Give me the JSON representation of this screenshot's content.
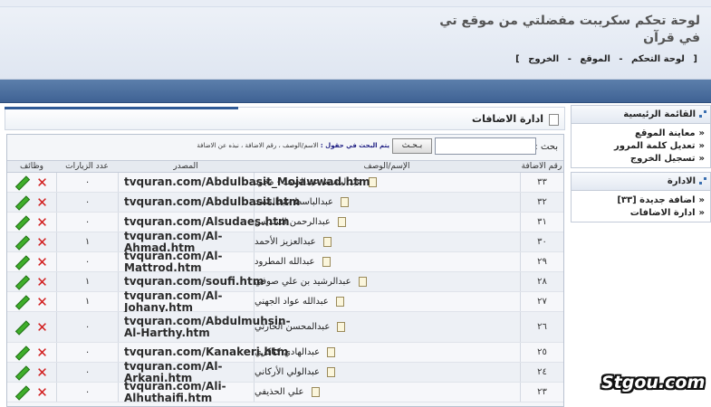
{
  "header": {
    "title_line1": "لوحة تحكم سكريبت مفضلتي من موقع تي",
    "title_line2": "في قرآن",
    "links": [
      "[",
      "لوحة التحكم",
      "-",
      "الموقع",
      "-",
      "الخروج",
      "]"
    ]
  },
  "sidebar": {
    "main_menu": {
      "title": "القائمة الرئيسية",
      "items": [
        "معاينة الموقع",
        "تعديل كلمة المرور",
        "تسجيل الخروج"
      ]
    },
    "admin_menu": {
      "title": "الادارة",
      "items": [
        "اضافة جديدة [٣٣]",
        "ادارة الاضافات"
      ]
    }
  },
  "main": {
    "title": "ادارة الاضافات",
    "search": {
      "label": "بحث :",
      "value": "",
      "button_label": "بـحـث",
      "hint_bold": "يتم البحث في حقول :",
      "hint_rest": "الاسم/الوصف ، رقم الاضافة ، نبذه عن الاضافة"
    },
    "table": {
      "headers": {
        "number": "رقم الاضافة",
        "name": "الإسم/الوصف",
        "source": "المصدر",
        "visits": "عدد الزيارات",
        "actions": "وظائف"
      },
      "rows": [
        {
          "number": "٣٣",
          "name": "عبدالباسط عبدالصمد - مجود",
          "source": "tvquran.com/Abdulbasit_Mojawwad.htm",
          "visits": "٠"
        },
        {
          "number": "٣٢",
          "name": "عبدالباسط عبدالصمد",
          "source": "tvquran.com/Abdulbasit.htm",
          "visits": "٠"
        },
        {
          "number": "٣١",
          "name": "عبدالرحمن السديس",
          "source": "tvquran.com/Alsudaes.htm",
          "visits": "٠"
        },
        {
          "number": "٣٠",
          "name": "عبدالعزيز الأحمد",
          "source": "tvquran.com/Al-Ahmad.htm",
          "visits": "١"
        },
        {
          "number": "٢٩",
          "name": "عبدالله المطرود",
          "source": "tvquran.com/Al-Mattrod.htm",
          "visits": "٠"
        },
        {
          "number": "٢٨",
          "name": "عبدالرشيد بن علي صوفي",
          "source": "tvquran.com/soufi.htm",
          "visits": "١"
        },
        {
          "number": "٢٧",
          "name": "عبدالله عواد الجهني",
          "source": "tvquran.com/Al-Johany.htm",
          "visits": "١"
        },
        {
          "number": "٢٦",
          "name": "عبدالمحسن الحارثي",
          "source": "tvquran.com/Abdulmuhsin-Al-Harthy.htm",
          "visits": "٠"
        },
        {
          "number": "٢٥",
          "name": "عبدالهادي كناكري",
          "source": "tvquran.com/Kanakeri.htm",
          "visits": "٠"
        },
        {
          "number": "٢٤",
          "name": "عبدالولي الأركاني",
          "source": "tvquran.com/Al-Arkani.htm",
          "visits": "٠"
        },
        {
          "number": "٢٣",
          "name": "علي الحذيفي",
          "source": "tvquran.com/Ali-Alhuthaifi.htm",
          "visits": "٠"
        }
      ]
    }
  },
  "watermark": "Stgou.com",
  "colors": {
    "header_bar": "#4a6d9e",
    "delete": "#d11b1b",
    "edit": "#3fae2a"
  }
}
